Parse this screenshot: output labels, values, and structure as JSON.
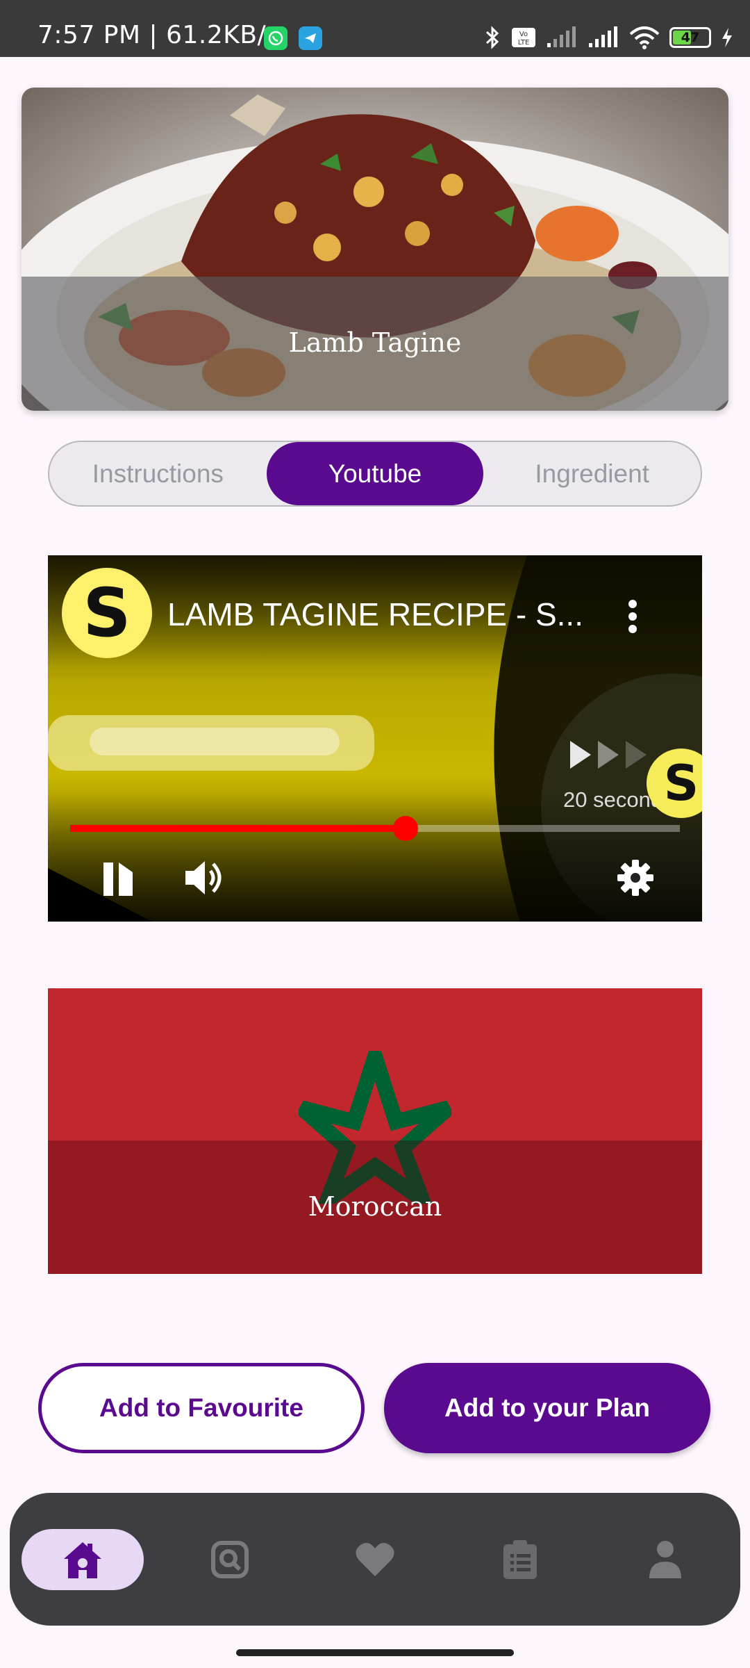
{
  "status_bar": {
    "time_speed": "7:57 PM | 61.2KB/s",
    "battery": "47",
    "icons": [
      "whatsapp-icon",
      "telegram-icon",
      "bluetooth-icon",
      "volte-icon",
      "signal-icon",
      "signal-icon",
      "wifi-icon",
      "battery-icon",
      "charging-icon"
    ]
  },
  "recipe": {
    "title": "Lamb Tagine",
    "cuisine": "Moroccan"
  },
  "tabs": [
    {
      "label": "Instructions",
      "active": false
    },
    {
      "label": "Youtube",
      "active": true
    },
    {
      "label": "Ingredient",
      "active": false
    }
  ],
  "video": {
    "title": "LAMB TAGINE RECIPE - S...",
    "channel_initial": "S",
    "countdown": "20 seconds",
    "progress": 0.55
  },
  "actions": {
    "favourite": "Add to Favourite",
    "plan": "Add to your Plan"
  },
  "bottom_nav": [
    {
      "icon": "home-icon",
      "active": true
    },
    {
      "icon": "search-icon",
      "active": false
    },
    {
      "icon": "heart-icon",
      "active": false
    },
    {
      "icon": "clipboard-icon",
      "active": false
    },
    {
      "icon": "person-icon",
      "active": false
    }
  ],
  "colors": {
    "primary": "#5a0a8e",
    "flag_red": "#c1272d",
    "flag_green": "#006233"
  }
}
